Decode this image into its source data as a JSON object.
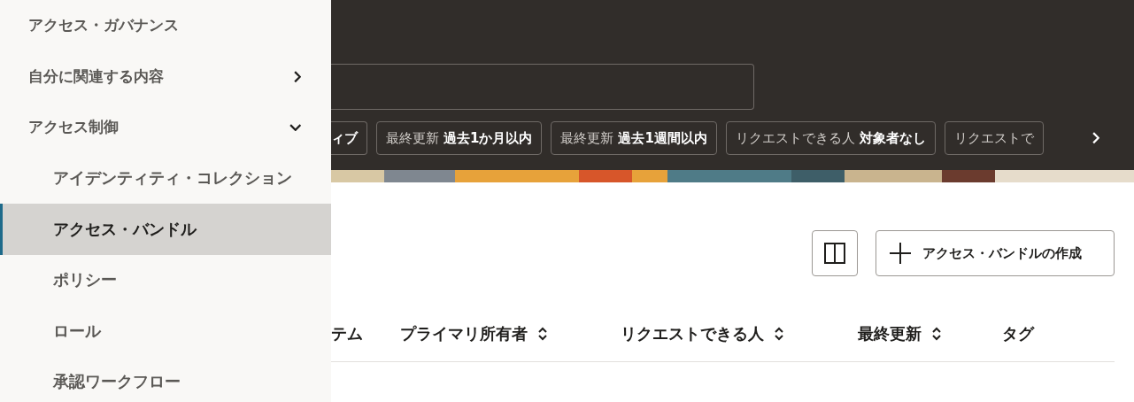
{
  "sidebar": {
    "items": [
      {
        "kind": "header",
        "label": "アクセス・ガバナンス"
      },
      {
        "kind": "group",
        "label": "自分に関連する内容",
        "expanded": false
      },
      {
        "kind": "group",
        "label": "アクセス制御",
        "expanded": true,
        "children": [
          {
            "label": "アイデンティティ・コレクション",
            "selected": false
          },
          {
            "label": "アクセス・バンドル",
            "selected": true
          },
          {
            "label": "ポリシー",
            "selected": false
          },
          {
            "label": "ロール",
            "selected": false
          },
          {
            "label": "承認ワークフロー",
            "selected": false
          }
        ]
      }
    ]
  },
  "filters": [
    {
      "value": "ィブ"
    },
    {
      "label": "最終更新",
      "value": "過去1か月以内"
    },
    {
      "label": "最終更新",
      "value": "過去1週間以内"
    },
    {
      "label": "リクエストできる人",
      "value": "対象者なし"
    },
    {
      "label": "リクエストで"
    }
  ],
  "create_button": "アクセス・バンドルの作成",
  "table": {
    "columns": [
      {
        "label": "テム",
        "sortable": false
      },
      {
        "label": "プライマリ所有者",
        "sortable": true
      },
      {
        "label": "リクエストできる人",
        "sortable": true
      },
      {
        "label": "最終更新",
        "sortable": true
      },
      {
        "label": "タグ",
        "sortable": false
      }
    ]
  }
}
